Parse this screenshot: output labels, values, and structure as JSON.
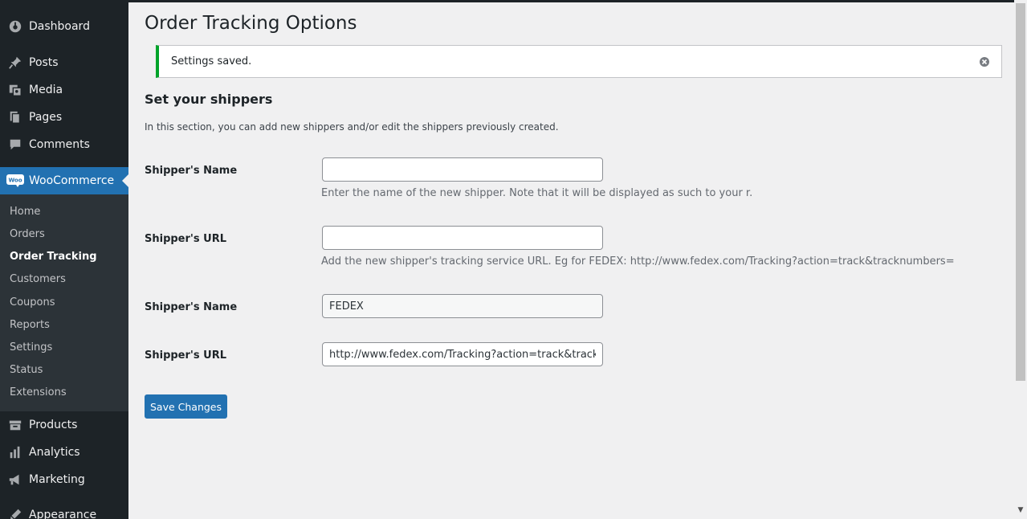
{
  "sidebar": {
    "top_items": [
      {
        "label": "Dashboard",
        "icon": "dashboard-icon"
      },
      {
        "label": "Posts",
        "icon": "pin-icon"
      },
      {
        "label": "Media",
        "icon": "media-icon"
      },
      {
        "label": "Pages",
        "icon": "pages-icon"
      },
      {
        "label": "Comments",
        "icon": "comment-icon"
      },
      {
        "label": "WooCommerce",
        "icon": "woo-icon"
      },
      {
        "label": "Products",
        "icon": "archive-icon"
      },
      {
        "label": "Analytics",
        "icon": "bar-chart-icon"
      },
      {
        "label": "Marketing",
        "icon": "megaphone-icon"
      },
      {
        "label": "Appearance",
        "icon": "brush-icon"
      }
    ],
    "woo_badge": "Woo",
    "submenu": [
      {
        "label": "Home"
      },
      {
        "label": "Orders"
      },
      {
        "label": "Order Tracking"
      },
      {
        "label": "Customers"
      },
      {
        "label": "Coupons"
      },
      {
        "label": "Reports"
      },
      {
        "label": "Settings"
      },
      {
        "label": "Status"
      },
      {
        "label": "Extensions"
      }
    ],
    "active_color": "#2271b1"
  },
  "page": {
    "title": "Order Tracking Options",
    "notice": "Settings saved.",
    "section_title": "Set your shippers",
    "section_desc": "In this section, you can add new shippers and/or edit the shippers previously created."
  },
  "form": {
    "new_name_label": "Shipper's Name",
    "new_name_value": "",
    "new_name_desc": "Enter the name of the new shipper. Note that it will be displayed as such to your r.",
    "new_url_label": "Shipper's URL",
    "new_url_value": "",
    "new_url_desc": "Add the new shipper's tracking service URL. Eg for FEDEX: http://www.fedex.com/Tracking?action=track&tracknumbers=",
    "existing_name_label": "Shipper's Name",
    "existing_name_value": "FEDEX",
    "existing_url_label": "Shipper's URL",
    "existing_url_value": "http://www.fedex.com/Tracking?action=track&tracknumbers=",
    "save_label": "Save Changes"
  },
  "colors": {
    "notice_success": "#00a32a",
    "button": "#2271b1"
  }
}
